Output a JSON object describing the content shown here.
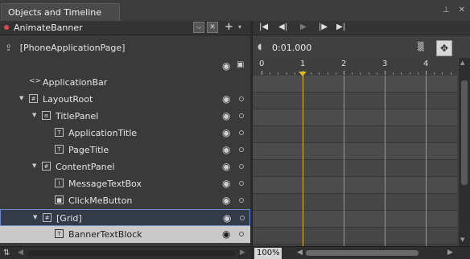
{
  "panel": {
    "title": "Objects and Timeline",
    "pin_icon": "pin-icon",
    "close_icon": "close-icon"
  },
  "storyboard": {
    "name": "AnimateBanner",
    "add_label": "+",
    "menu_label": "▾"
  },
  "scope": {
    "label": "[PhoneApplicationPage]"
  },
  "tree": [
    {
      "label": "ApplicationBar",
      "icon": "brackets-icon",
      "glyph": "<>",
      "level": 1,
      "expander": false,
      "eye": false
    },
    {
      "label": "LayoutRoot",
      "icon": "grid-icon",
      "glyph": "#",
      "level": 1,
      "expander": true,
      "eye": true
    },
    {
      "label": "TitlePanel",
      "icon": "stackpanel-icon",
      "glyph": "≡",
      "level": 2,
      "expander": true,
      "eye": true
    },
    {
      "label": "ApplicationTitle",
      "icon": "textblock-icon",
      "glyph": "T",
      "level": 3,
      "expander": false,
      "eye": true
    },
    {
      "label": "PageTitle",
      "icon": "textblock-icon",
      "glyph": "T",
      "level": 3,
      "expander": false,
      "eye": true
    },
    {
      "label": "ContentPanel",
      "icon": "grid-icon",
      "glyph": "#",
      "level": 2,
      "expander": true,
      "eye": true
    },
    {
      "label": "MessageTextBox",
      "icon": "textbox-icon",
      "glyph": "I",
      "level": 3,
      "expander": false,
      "eye": true
    },
    {
      "label": "ClickMeButton",
      "icon": "button-icon",
      "glyph": "■",
      "level": 3,
      "expander": false,
      "eye": true
    },
    {
      "label": "[Grid]",
      "icon": "grid-icon",
      "glyph": "#",
      "level": 2,
      "expander": true,
      "eye": true,
      "selected": "outline"
    },
    {
      "label": "BannerTextBlock",
      "icon": "textblock-icon",
      "glyph": "T",
      "level": 3,
      "expander": false,
      "eye": true,
      "selected": "fill"
    }
  ],
  "timeline": {
    "current_time": "0:01.000",
    "ruler_labels": [
      "0",
      "1",
      "2",
      "3",
      "4"
    ],
    "playhead_seconds": 1,
    "zoom": "100%"
  },
  "colors": {
    "playhead": "#e0b81e",
    "selection_outline": "#6d88c8",
    "selection_fill": "#c9c9c9"
  }
}
